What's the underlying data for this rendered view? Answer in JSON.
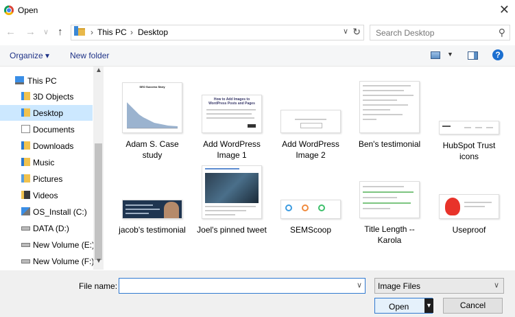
{
  "window": {
    "title": "Open",
    "close_glyph": "✕"
  },
  "nav": {
    "back": "←",
    "forward": "→",
    "recent": "∨",
    "up": "↑"
  },
  "address": {
    "crumbs": [
      "This PC",
      "Desktop"
    ],
    "separator": "›",
    "dropdown_glyph": "∨",
    "refresh_glyph": "↻"
  },
  "search": {
    "placeholder": "Search Desktop",
    "value": "",
    "icon_glyph": "⚲"
  },
  "toolbar": {
    "organize_label": "Organize ▾",
    "new_folder_label": "New folder",
    "view_dd_glyph": "▼",
    "help_glyph": "?"
  },
  "sidebar": {
    "items": [
      {
        "label": "This PC",
        "icon": "computer-icon",
        "selected": false
      },
      {
        "label": "3D Objects",
        "icon": "folder-icon",
        "selected": false
      },
      {
        "label": "Desktop",
        "icon": "folder-icon",
        "selected": true
      },
      {
        "label": "Documents",
        "icon": "documents-icon",
        "selected": false
      },
      {
        "label": "Downloads",
        "icon": "downloads-icon",
        "selected": false
      },
      {
        "label": "Music",
        "icon": "music-icon",
        "selected": false
      },
      {
        "label": "Pictures",
        "icon": "pictures-icon",
        "selected": false
      },
      {
        "label": "Videos",
        "icon": "videos-icon",
        "selected": false
      },
      {
        "label": "OS_Install (C:)",
        "icon": "windows-drive-icon",
        "selected": false
      },
      {
        "label": "DATA (D:)",
        "icon": "drive-icon",
        "selected": false
      },
      {
        "label": "New Volume (E:)",
        "icon": "drive-icon",
        "selected": false
      },
      {
        "label": "New Volume (F:)",
        "icon": "drive-icon",
        "selected": false
      }
    ],
    "scroll_up": "▲",
    "scroll_down": "▼"
  },
  "files": [
    {
      "name": "Adam S. Case study",
      "thumb_title": "SEO Success Story"
    },
    {
      "name": "Add WordPress Image 1",
      "thumb_title": "How to Add Images to WordPress Posts and Pages"
    },
    {
      "name": "Add WordPress Image 2"
    },
    {
      "name": "Ben's testimonial"
    },
    {
      "name": "HubSpot Trust icons"
    },
    {
      "name": "jacob's testimonial"
    },
    {
      "name": "Joel's pinned tweet"
    },
    {
      "name": "SEMScoop"
    },
    {
      "name": "Title Length -- Karola"
    },
    {
      "name": "Useproof"
    }
  ],
  "bottom": {
    "file_name_label": "File name:",
    "file_name_value": "",
    "file_type": "Image Files",
    "dropdown_glyph": "∨",
    "open_label": "Open",
    "split_glyph": "▼",
    "cancel_label": "Cancel"
  }
}
